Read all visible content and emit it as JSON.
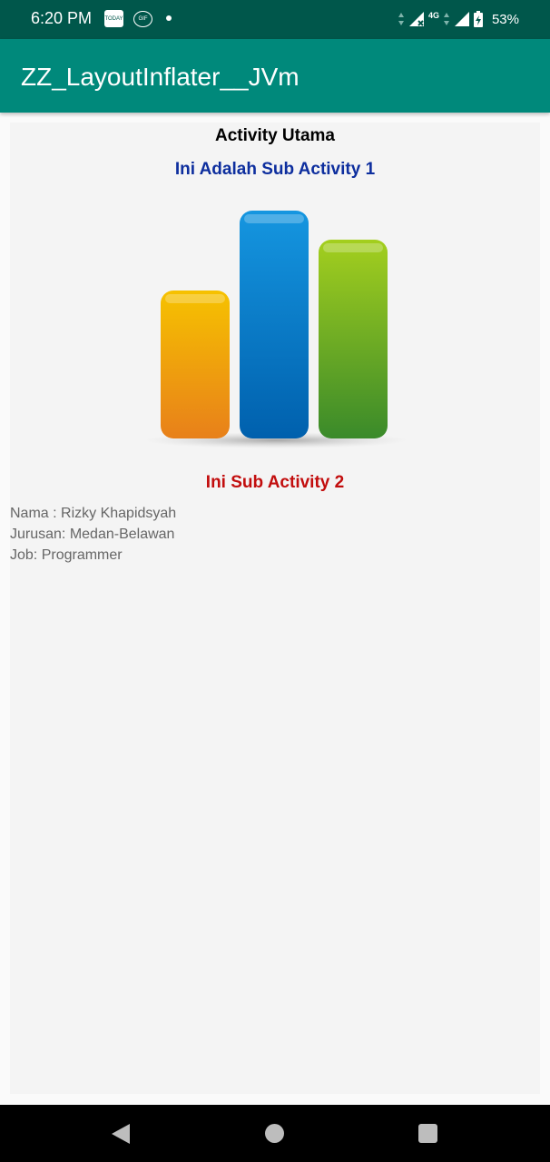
{
  "status_bar": {
    "time": "6:20 PM",
    "notification_icons": [
      "today-icon",
      "gif-icon",
      "dot-icon"
    ],
    "today_label": "TODAY",
    "gif_label": "GIF",
    "network_label": "4G",
    "battery": "53%"
  },
  "app_bar": {
    "title": "ZZ_LayoutInflater__JVm"
  },
  "main": {
    "heading": "Activity Utama",
    "sub_activity_1": "Ini Adalah Sub Activity 1",
    "image": "bar-chart-image",
    "sub_activity_2": "Ini Sub Activity 2",
    "info": {
      "nama": "Nama : Rizky Khapidsyah",
      "jurusan": "Jurusan: Medan-Belawan",
      "job": "Job: Programmer"
    }
  },
  "colors": {
    "status_bar": "#00574b",
    "app_bar": "#00897b",
    "sub_activity_1_text": "#0d2e9e",
    "sub_activity_2_text": "#c20d0d"
  },
  "nav_bar": {
    "buttons": [
      "back-icon",
      "home-icon",
      "recents-icon"
    ]
  }
}
